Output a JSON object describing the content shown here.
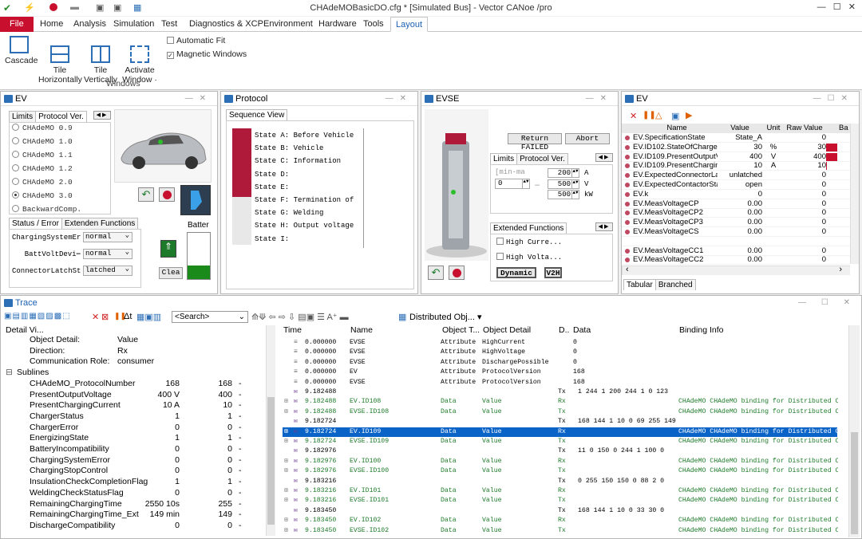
{
  "app": {
    "title": "CHAdeMOBasicDO.cfg * [Simulated Bus] - Vector CANoe /pro"
  },
  "menu": [
    "File",
    "Home",
    "Analysis",
    "Simulation",
    "Test",
    "Diagnostics & XCP",
    "Environment",
    "Hardware",
    "Tools",
    "Layout"
  ],
  "ribbon": {
    "buttons": [
      {
        "label": "Cascade",
        "icon": "cascade-icon"
      },
      {
        "label": "Tile\nHorizontally",
        "icon": "tile-horizontal-icon"
      },
      {
        "label": "Tile\nVertically",
        "icon": "tile-vertical-icon"
      },
      {
        "label": "Activate\nWindow ·",
        "icon": "activate-window-icon"
      }
    ],
    "checks": [
      {
        "label": "Automatic Fit",
        "checked": false
      },
      {
        "label": "Magnetic Windows",
        "checked": true
      }
    ],
    "group": "Windows"
  },
  "ev": {
    "title": "EV",
    "tabs": [
      "Limits",
      "Protocol Ver."
    ],
    "versions": [
      "CHAdeMO 0.9",
      "CHAdeMO 1.0",
      "CHAdeMO 1.1",
      "CHAdeMO 1.2",
      "CHAdeMO 2.0",
      "CHAdeMO 3.0",
      "BackwardComp."
    ],
    "selected_version": "CHAdeMO 3.0",
    "bottom_tabs": [
      "Status / Error",
      "Extenden Functions"
    ],
    "status_rows": [
      {
        "label": "ChargingSystemEr⋯",
        "value": "normal"
      },
      {
        "label": "BattVoltDevi⋯",
        "value": "normal"
      },
      {
        "label": "ConnectorLatchSt⋯",
        "value": "latched"
      }
    ],
    "battery_label": "Batter",
    "battery_level": 0.3,
    "clear_label": "Clea"
  },
  "protocol": {
    "title": "Protocol",
    "tab": "Sequence View",
    "states": [
      "State A: Before Vehicle",
      "State B: Vehicle",
      "State C: Information",
      "State D:",
      "State E:",
      "State F: Termination of",
      "State G: Welding",
      "State H: Output voltage",
      "State I:"
    ]
  },
  "evse": {
    "title": "EVSE",
    "return_failed": "Return FAILED",
    "abort": "Abort",
    "tabs": [
      "Limits",
      "Protocol Ver."
    ],
    "min_placeholder": "[min-ma",
    "min_value": "0",
    "limits": [
      {
        "value": "200",
        "unit": "A"
      },
      {
        "value": "500",
        "unit": "V"
      },
      {
        "value": "500",
        "unit": "kW"
      }
    ],
    "ext_tab": "Extended Functions",
    "checks": [
      "High Curre...",
      "High Volta..."
    ],
    "dynamic": "Dynamic",
    "v2h": "V2H"
  },
  "evdata": {
    "title": "EV",
    "headers": [
      "Name",
      "Value",
      "Unit",
      "Raw Value",
      "Ba"
    ],
    "rows": [
      {
        "name": "EV.SpecificationState",
        "value": "State_A",
        "unit": "",
        "raw": "0",
        "bar": 0
      },
      {
        "name": "EV.ID102.StateOfCharge",
        "value": "30",
        "unit": "%",
        "raw": "30",
        "bar": 1
      },
      {
        "name": "EV.ID109.PresentOutputV...",
        "value": "400",
        "unit": "V",
        "raw": "400",
        "bar": 1
      },
      {
        "name": "EV.ID109.PresentChargin...",
        "value": "10",
        "unit": "A",
        "raw": "10",
        "bar": 0.1
      },
      {
        "name": "EV.ExpectedConnectorLat...",
        "value": "unlatched",
        "unit": "",
        "raw": "0",
        "bar": 0
      },
      {
        "name": "EV.ExpectedContactorState",
        "value": "open",
        "unit": "",
        "raw": "0",
        "bar": 0
      },
      {
        "name": "EV.k",
        "value": "0",
        "unit": "",
        "raw": "0",
        "bar": 0
      },
      {
        "name": "EV.MeasVoltageCP",
        "value": "0.00",
        "unit": "",
        "raw": "0",
        "bar": 0
      },
      {
        "name": "EV.MeasVoltageCP2",
        "value": "0.00",
        "unit": "",
        "raw": "0",
        "bar": 0
      },
      {
        "name": "EV.MeasVoltageCP3",
        "value": "0.00",
        "unit": "",
        "raw": "0",
        "bar": 0
      },
      {
        "name": "EV.MeasVoltageCS",
        "value": "0.00",
        "unit": "",
        "raw": "0",
        "bar": 0
      },
      {
        "name": "",
        "value": "",
        "unit": "",
        "raw": "",
        "bar": 0
      },
      {
        "name": "EV.MeasVoltageCC1",
        "value": "0.00",
        "unit": "",
        "raw": "0",
        "bar": 0
      },
      {
        "name": "EV.MeasVoltageCC2",
        "value": "0.00",
        "unit": "",
        "raw": "0",
        "bar": 0
      }
    ],
    "bottom_tabs": [
      "Tabular",
      "Branched"
    ]
  },
  "trace": {
    "title": "Trace",
    "search_placeholder": "<Search>",
    "dist_label": "Distributed Obj...",
    "detail_header": "Detail Vi...",
    "details": [
      {
        "indent": 2,
        "name": "Object Detail:",
        "v1": "Value",
        "v2": "",
        "u": ""
      },
      {
        "indent": 2,
        "name": "Direction:",
        "v1": "Rx",
        "v2": "",
        "u": ""
      },
      {
        "indent": 2,
        "name": "Communication Role:",
        "v1": "consumer",
        "v2": "",
        "u": ""
      },
      {
        "indent": 0,
        "name": "Sublines",
        "v1": "",
        "v2": "",
        "u": "",
        "exp": "⊟"
      },
      {
        "indent": 2,
        "name": "CHAdeMO_ProtocolNumber",
        "v1": "168",
        "v2": "168",
        "u": "-"
      },
      {
        "indent": 2,
        "name": "PresentOutputVoltage",
        "v1": "400 V",
        "v2": "400",
        "u": "-"
      },
      {
        "indent": 2,
        "name": "PresentChargingCurrent",
        "v1": "10 A",
        "v2": "10",
        "u": "-"
      },
      {
        "indent": 2,
        "name": "ChargerStatus",
        "v1": "1",
        "v2": "1",
        "u": "-"
      },
      {
        "indent": 2,
        "name": "ChargerError",
        "v1": "0",
        "v2": "0",
        "u": "-"
      },
      {
        "indent": 2,
        "name": "EnergizingState",
        "v1": "1",
        "v2": "1",
        "u": "-"
      },
      {
        "indent": 2,
        "name": "BatteryIncompatibility",
        "v1": "0",
        "v2": "0",
        "u": "-"
      },
      {
        "indent": 2,
        "name": "ChargingSystemError",
        "v1": "0",
        "v2": "0",
        "u": "-"
      },
      {
        "indent": 2,
        "name": "ChargingStopControl",
        "v1": "0",
        "v2": "0",
        "u": "-"
      },
      {
        "indent": 2,
        "name": "InsulationCheckCompletionFlag",
        "v1": "1",
        "v2": "1",
        "u": "-"
      },
      {
        "indent": 2,
        "name": "WeldingCheckStatusFlag",
        "v1": "0",
        "v2": "0",
        "u": "-"
      },
      {
        "indent": 2,
        "name": "RemainingChargingTime",
        "v1": "2550 10s",
        "v2": "255",
        "u": "-"
      },
      {
        "indent": 2,
        "name": "RemainingChargingTime_Ext",
        "v1": "149 min",
        "v2": "149",
        "u": "-"
      },
      {
        "indent": 2,
        "name": "DischargeCompatibility",
        "v1": "0",
        "v2": "0",
        "u": "-"
      }
    ],
    "headers": [
      "Time",
      "Name",
      "Object T...",
      "Object Detail",
      "D..",
      "Data",
      "Binding Info"
    ],
    "rows": [
      {
        "time": "0.000000",
        "name": "EVSE",
        "type": "Attribute",
        "detail": "HighCurrent",
        "dir": "",
        "data": "0",
        "binding": "",
        "kind": "attr"
      },
      {
        "time": "0.000000",
        "name": "EVSE",
        "type": "Attribute",
        "detail": "HighVoltage",
        "dir": "",
        "data": "0",
        "binding": "",
        "kind": "attr"
      },
      {
        "time": "0.000000",
        "name": "EVSE",
        "type": "Attribute",
        "detail": "DischargePossible",
        "dir": "",
        "data": "0",
        "binding": "",
        "kind": "attr"
      },
      {
        "time": "0.000000",
        "name": "EV",
        "type": "Attribute",
        "detail": "ProtocolVersion",
        "dir": "",
        "data": "168",
        "binding": "",
        "kind": "attr"
      },
      {
        "time": "0.000000",
        "name": "EVSE",
        "type": "Attribute",
        "detail": "ProtocolVersion",
        "dir": "",
        "data": "168",
        "binding": "",
        "kind": "attr"
      },
      {
        "time": "9.182488",
        "name": "",
        "type": "",
        "detail": "",
        "dir": "Tx",
        "data": "1 244   1 200 244   1   0  123",
        "binding": "",
        "kind": "msg"
      },
      {
        "time": "9.182488",
        "name": "EV.ID108",
        "type": "Data",
        "detail": "Value",
        "dir": "Rx",
        "data": "",
        "binding": "CHAdeMO CHAdeMO binding for Distributed Objects",
        "kind": "data"
      },
      {
        "time": "9.182488",
        "name": "EVSE.ID108",
        "type": "Data",
        "detail": "Value",
        "dir": "Tx",
        "data": "",
        "binding": "CHAdeMO CHAdeMO binding for Distributed Objects",
        "kind": "data"
      },
      {
        "time": "9.182724",
        "name": "",
        "type": "",
        "detail": "",
        "dir": "Tx",
        "data": "168 144   1  10   0  69 255 149",
        "binding": "",
        "kind": "msg"
      },
      {
        "time": "9.182724",
        "name": "EV.ID109",
        "type": "Data",
        "detail": "Value",
        "dir": "Rx",
        "data": "",
        "binding": "CHAdeMO CHAdeMO binding for Distributed Objects",
        "kind": "sel"
      },
      {
        "time": "9.182724",
        "name": "EVSE.ID109",
        "type": "Data",
        "detail": "Value",
        "dir": "Tx",
        "data": "",
        "binding": "CHAdeMO CHAdeMO binding for Distributed Objects",
        "kind": "data"
      },
      {
        "time": "9.182976",
        "name": "",
        "type": "",
        "detail": "",
        "dir": "Tx",
        "data": "11   0 150   0 244   1 100   0",
        "binding": "",
        "kind": "msg"
      },
      {
        "time": "9.182976",
        "name": "EV.ID100",
        "type": "Data",
        "detail": "Value",
        "dir": "Rx",
        "data": "",
        "binding": "CHAdeMO CHAdeMO binding for Distributed Objects",
        "kind": "data"
      },
      {
        "time": "9.182976",
        "name": "EVSE.ID100",
        "type": "Data",
        "detail": "Value",
        "dir": "Tx",
        "data": "",
        "binding": "CHAdeMO CHAdeMO binding for Distributed Objects",
        "kind": "data"
      },
      {
        "time": "9.183216",
        "name": "",
        "type": "",
        "detail": "",
        "dir": "Tx",
        "data": "0 255 150 150   0  88   2   0",
        "binding": "",
        "kind": "msg"
      },
      {
        "time": "9.183216",
        "name": "EV.ID101",
        "type": "Data",
        "detail": "Value",
        "dir": "Rx",
        "data": "",
        "binding": "CHAdeMO CHAdeMO binding for Distributed Objects",
        "kind": "data"
      },
      {
        "time": "9.183216",
        "name": "EVSE.ID101",
        "type": "Data",
        "detail": "Value",
        "dir": "Tx",
        "data": "",
        "binding": "CHAdeMO CHAdeMO binding for Distributed Objects",
        "kind": "data"
      },
      {
        "time": "9.183450",
        "name": "",
        "type": "",
        "detail": "",
        "dir": "Tx",
        "data": "168 144   1  10   0  33  30   0",
        "binding": "",
        "kind": "msg"
      },
      {
        "time": "9.183450",
        "name": "EV.ID102",
        "type": "Data",
        "detail": "Value",
        "dir": "Rx",
        "data": "",
        "binding": "CHAdeMO CHAdeMO binding for Distributed Objects",
        "kind": "data"
      },
      {
        "time": "9.183450",
        "name": "EVSE.ID102",
        "type": "Data",
        "detail": "Value",
        "dir": "Tx",
        "data": "",
        "binding": "CHAdeMO CHAdeMO binding for Distributed Objects",
        "kind": "data"
      }
    ]
  },
  "colors": {
    "accent": "#c8102e",
    "blue": "#2c6fb7",
    "green": "#1d7a2a",
    "selection": "#0a64c8"
  }
}
